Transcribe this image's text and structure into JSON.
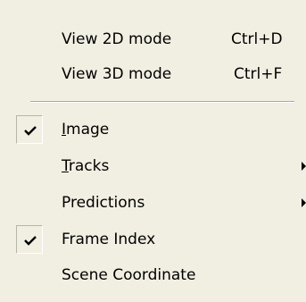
{
  "menu": {
    "view_modes": [
      {
        "label": "View 2D mode",
        "shortcut": "Ctrl+D"
      },
      {
        "label": "View 3D mode",
        "shortcut": "Ctrl+F"
      }
    ],
    "image": {
      "mnemonic": "I",
      "rest": "mage",
      "checked": true
    },
    "tracks": {
      "mnemonic": "T",
      "rest": "racks",
      "has_submenu": true
    },
    "predictions": {
      "label": "Predictions",
      "has_submenu": true
    },
    "frame_index": {
      "label": "Frame Index",
      "checked": true
    },
    "scene_coordinate": {
      "label": "Scene Coordinate"
    }
  }
}
